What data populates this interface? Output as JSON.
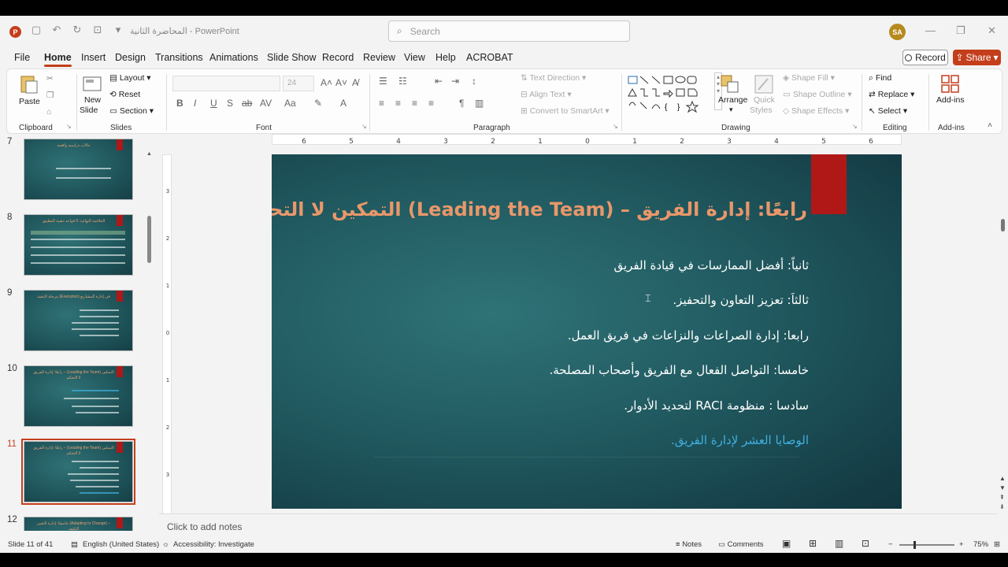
{
  "titlebar": {
    "doc_title": "المحاضرة الثانية",
    "app_name": "PowerPoint",
    "search_placeholder": "Search",
    "avatar_initials": "SA"
  },
  "menu": {
    "tabs": [
      "File",
      "Home",
      "Insert",
      "Design",
      "Transitions",
      "Animations",
      "Slide Show",
      "Record",
      "Review",
      "View",
      "Help",
      "ACROBAT"
    ],
    "active_tab": "Home",
    "record_label": "Record",
    "share_label": "Share"
  },
  "ribbon": {
    "clipboard": {
      "label": "Clipboard",
      "paste": "Paste"
    },
    "slides": {
      "label": "Slides",
      "new_slide_1": "New",
      "new_slide_2": "Slide",
      "layout": "Layout",
      "reset": "Reset",
      "section": "Section"
    },
    "font": {
      "label": "Font",
      "size": "24"
    },
    "paragraph": {
      "label": "Paragraph",
      "text_direction": "Text Direction",
      "align_text": "Align Text",
      "convert_smartart": "Convert to SmartArt"
    },
    "drawing": {
      "label": "Drawing",
      "arrange": "Arrange",
      "quick_styles_1": "Quick",
      "quick_styles_2": "Styles",
      "shape_fill": "Shape Fill",
      "shape_outline": "Shape Outline",
      "shape_effects": "Shape Effects"
    },
    "editing": {
      "label": "Editing",
      "find": "Find",
      "replace": "Replace",
      "select": "Select"
    },
    "addins": {
      "label": "Add-ins",
      "button": "Add-ins"
    }
  },
  "thumbnails": [
    {
      "num": "7",
      "title": "حالات دراسية واقعية",
      "active": false
    },
    {
      "num": "8",
      "title": "الخلاصة النهائية: 5 قواعد ذهبية للتطبيق",
      "active": false
    },
    {
      "num": "9",
      "title": "مرحلة التنفيذ (Execution) في إدارة المشاريع",
      "active": false
    },
    {
      "num": "10",
      "title": "رابعًا: إدارة الفريق – (Leading the Team) التمكين لا التحكم",
      "active": false
    },
    {
      "num": "11",
      "title": "رابعًا: إدارة الفريق – (Leading the Team) التمكين لا التحكم",
      "active": true
    },
    {
      "num": "12",
      "title": "خامسًا: إدارة التغيير (Adapting to Change) – التكيف",
      "active": false
    }
  ],
  "slide": {
    "title": "رابعًا: إدارة الفريق – (Leading the Team) التمكين لا التحكم",
    "bullets": [
      "ثانياً: أفضل الممارسات في قيادة الفريق",
      "ثالثاَ: تعزيز التعاون والتحفيز.",
      "رابعا: إدارة الصراعات والنزاعات في فريق العمل.",
      "خامسا: التواصل الفعال مع الفريق وأصحاب المصلحة.",
      "سادسا : منظومة  RACI لتحديد الأدوار."
    ],
    "link_bullet": "الوصايا العشر لإدارة الفريق.",
    "colors": {
      "title": "#e9976a",
      "link": "#3fb0e0",
      "accent_bar": "#b01818",
      "background": "#215b61"
    }
  },
  "notes_placeholder": "Click to add notes",
  "status": {
    "slide_info": "Slide 11 of 41",
    "language": "English (United States)",
    "accessibility": "Accessibility: Investigate",
    "notes": "Notes",
    "comments": "Comments",
    "zoom": "75%"
  }
}
